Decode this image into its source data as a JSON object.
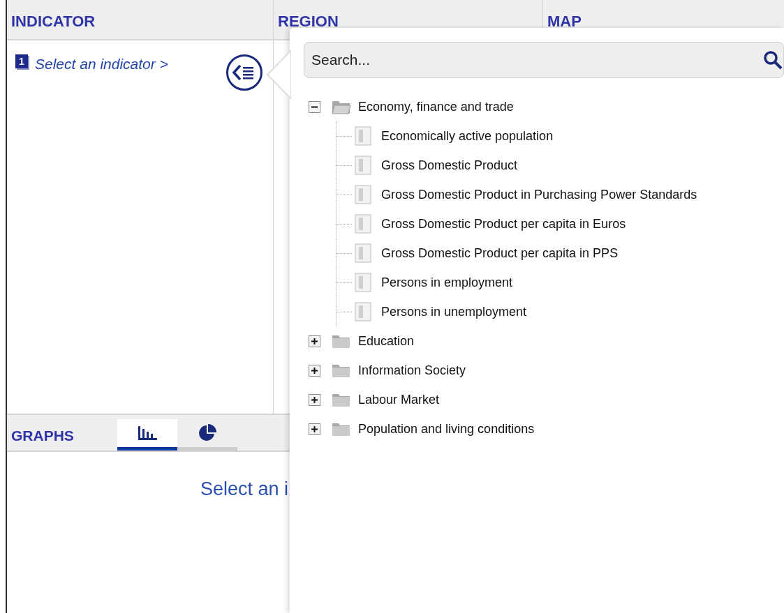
{
  "headers": {
    "indicator": "INDICATOR",
    "region": "REGION",
    "map": "MAP"
  },
  "indicator": {
    "step": "1",
    "prompt": "Select an indicator >"
  },
  "graphs": {
    "title": "GRAPHS",
    "tabs": [
      {
        "kind": "bar",
        "selected": true
      },
      {
        "kind": "pie",
        "selected": false
      }
    ],
    "message": "Select an i"
  },
  "picker": {
    "search": {
      "placeholder": "Search..."
    },
    "tree": [
      {
        "kind": "folder",
        "label": "Economy, finance and trade",
        "expanded": true,
        "children": [
          {
            "kind": "document",
            "label": "Economically active population"
          },
          {
            "kind": "document",
            "label": "Gross Domestic Product"
          },
          {
            "kind": "document",
            "label": "Gross Domestic Product in Purchasing Power Standards"
          },
          {
            "kind": "document",
            "label": "Gross Domestic Product per capita in Euros"
          },
          {
            "kind": "document",
            "label": "Gross Domestic Product per capita in PPS"
          },
          {
            "kind": "document",
            "label": "Persons in employment"
          },
          {
            "kind": "document",
            "label": "Persons in unemployment"
          }
        ]
      },
      {
        "kind": "folder",
        "label": "Education",
        "expanded": false
      },
      {
        "kind": "folder",
        "label": "Information Society",
        "expanded": false
      },
      {
        "kind": "folder",
        "label": "Labour Market",
        "expanded": false
      },
      {
        "kind": "folder",
        "label": "Population and living conditions",
        "expanded": false
      }
    ]
  }
}
